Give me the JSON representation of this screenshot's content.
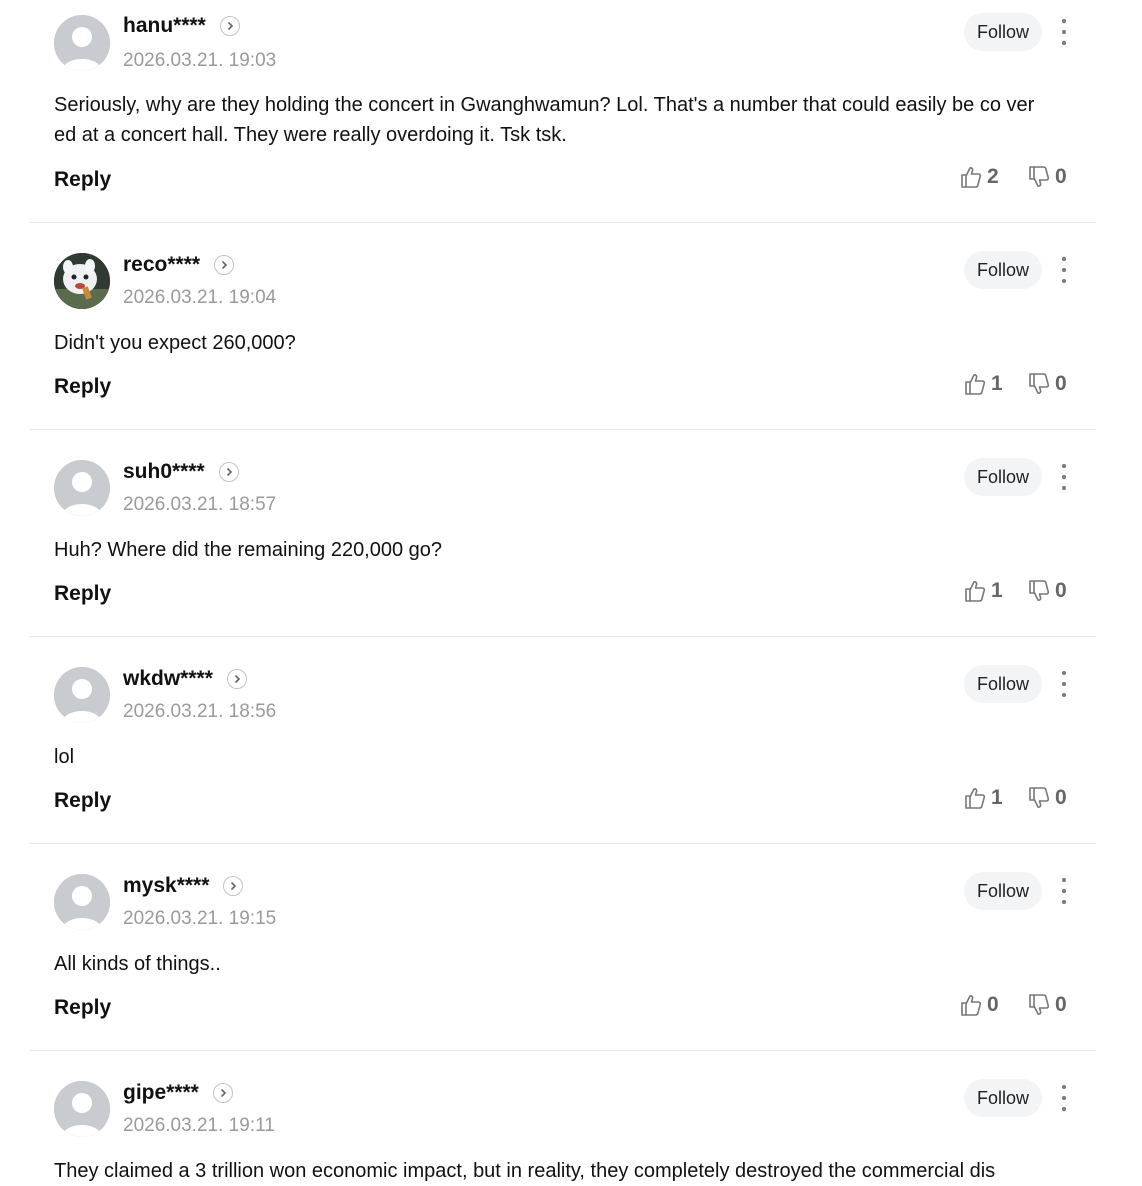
{
  "ui": {
    "follow_label": "Follow",
    "reply_label": "Reply"
  },
  "comments": [
    {
      "nickname": "hanu****",
      "time": "2026.03.21. 19:03",
      "text": "Seriously, why are they holding the concert in Gwanghwamun? Lol. That's a number that could easily be co vered at a concert hall. They were really overdoing it. Tsk tsk.",
      "likes": "2",
      "dislikes": "0",
      "avatar": "default"
    },
    {
      "nickname": "reco****",
      "time": "2026.03.21. 19:04",
      "text": "Didn't you expect 260,000?",
      "likes": "1",
      "dislikes": "0",
      "avatar": "photo"
    },
    {
      "nickname": "suh0****",
      "time": "2026.03.21. 18:57",
      "text": "Huh? Where did the remaining 220,000 go?",
      "likes": "1",
      "dislikes": "0",
      "avatar": "default"
    },
    {
      "nickname": "wkdw****",
      "time": "2026.03.21. 18:56",
      "text": "lol",
      "likes": "1",
      "dislikes": "0",
      "avatar": "default"
    },
    {
      "nickname": "mysk****",
      "time": "2026.03.21. 19:15",
      "text": "All kinds of things..",
      "likes": "0",
      "dislikes": "0",
      "avatar": "default"
    },
    {
      "nickname": "gipe****",
      "time": "2026.03.21. 19:11",
      "text": "They claimed a 3 trillion won economic impact, but in reality, they completely destroyed the commercial dis",
      "likes": "",
      "dislikes": "",
      "avatar": "default"
    }
  ]
}
